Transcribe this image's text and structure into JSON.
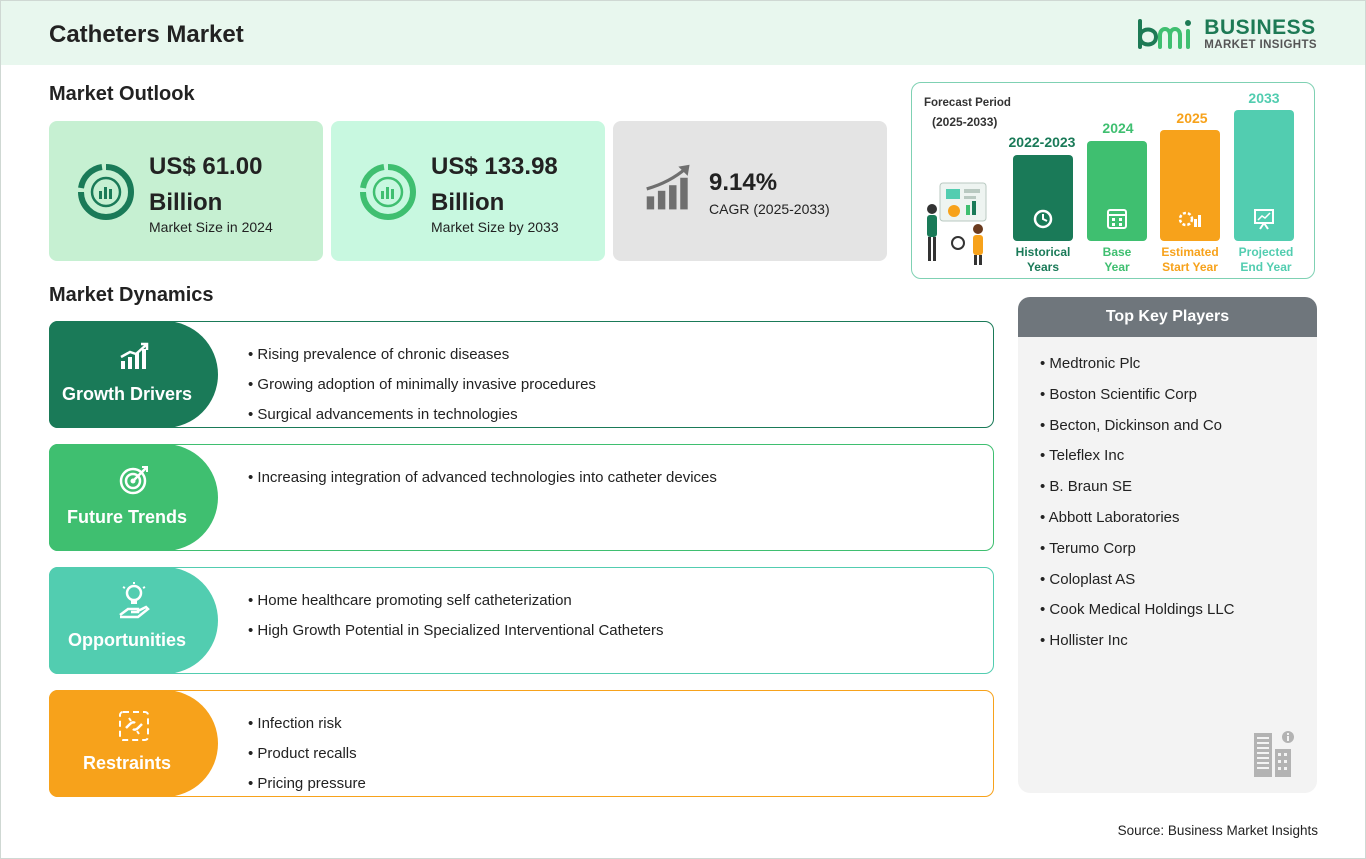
{
  "header": {
    "title": "Catheters Market"
  },
  "logo": {
    "line1": "BUSINESS",
    "line2": "MARKET INSIGHTS",
    "mark": "bmi"
  },
  "outlook": {
    "title": "Market Outlook",
    "stats": [
      {
        "line1": "US$ 61.00",
        "line2": "Billion",
        "caption": "Market Size in 2024",
        "icon": "chart-donut-icon",
        "bg": "#c6f0d2"
      },
      {
        "line1": "US$ 133.98",
        "line2": "Billion",
        "caption": "Market Size by 2033",
        "icon": "chart-donut-icon",
        "bg": "#c8f8e0"
      },
      {
        "value": "9.14%",
        "caption": "CAGR (2025-2033)",
        "icon": "growth-bars-icon",
        "bg": "#e4e4e4"
      }
    ]
  },
  "timeline": {
    "heading1": "Forecast Period",
    "heading2": "(2025-2033)",
    "items": [
      {
        "year": "2022-2023",
        "label1": "Historical",
        "label2": "Years",
        "color": "#1a7a58",
        "icon": "history-icon"
      },
      {
        "year": "2024",
        "label1": "Base",
        "label2": "Year",
        "color": "#3fbf70",
        "icon": "calendar-icon"
      },
      {
        "year": "2025",
        "label1": "Estimated",
        "label2": "Start Year",
        "color": "#f7a21b",
        "icon": "gear-chart-icon"
      },
      {
        "year": "2033",
        "label1": "Projected",
        "label2": "End Year",
        "color": "#52cdb0",
        "icon": "presentation-icon"
      }
    ]
  },
  "dynamics": {
    "title": "Market Dynamics",
    "blocks": [
      {
        "title": "Growth Drivers",
        "color": "#1a7a58",
        "icon": "growth-chart-icon",
        "items": [
          "Rising prevalence of chronic diseases",
          "Growing adoption of minimally invasive procedures",
          "Surgical advancements in technologies"
        ]
      },
      {
        "title": "Future Trends",
        "color": "#3fbf70",
        "icon": "target-icon",
        "items": [
          "Increasing integration of advanced technologies into catheter devices"
        ]
      },
      {
        "title": "Opportunities",
        "color": "#52cdb0",
        "icon": "lightbulb-hand-icon",
        "items": [
          "Home healthcare promoting self catheterization",
          "High Growth Potential in Specialized Interventional Catheters"
        ]
      },
      {
        "title": "Restraints",
        "color": "#f7a21b",
        "icon": "broken-chain-icon",
        "items": [
          "Infection risk",
          "Product recalls",
          "Pricing pressure"
        ]
      }
    ]
  },
  "players": {
    "title": "Top Key Players",
    "items": [
      "Medtronic Plc",
      "Boston Scientific Corp",
      "Becton, Dickinson and Co",
      "Teleflex Inc",
      "B. Braun SE",
      "Abbott Laboratories",
      "Terumo Corp",
      "Coloplast AS",
      "Cook Medical Holdings LLC",
      "Hollister Inc"
    ]
  },
  "source": "Source: Business Market Insights"
}
